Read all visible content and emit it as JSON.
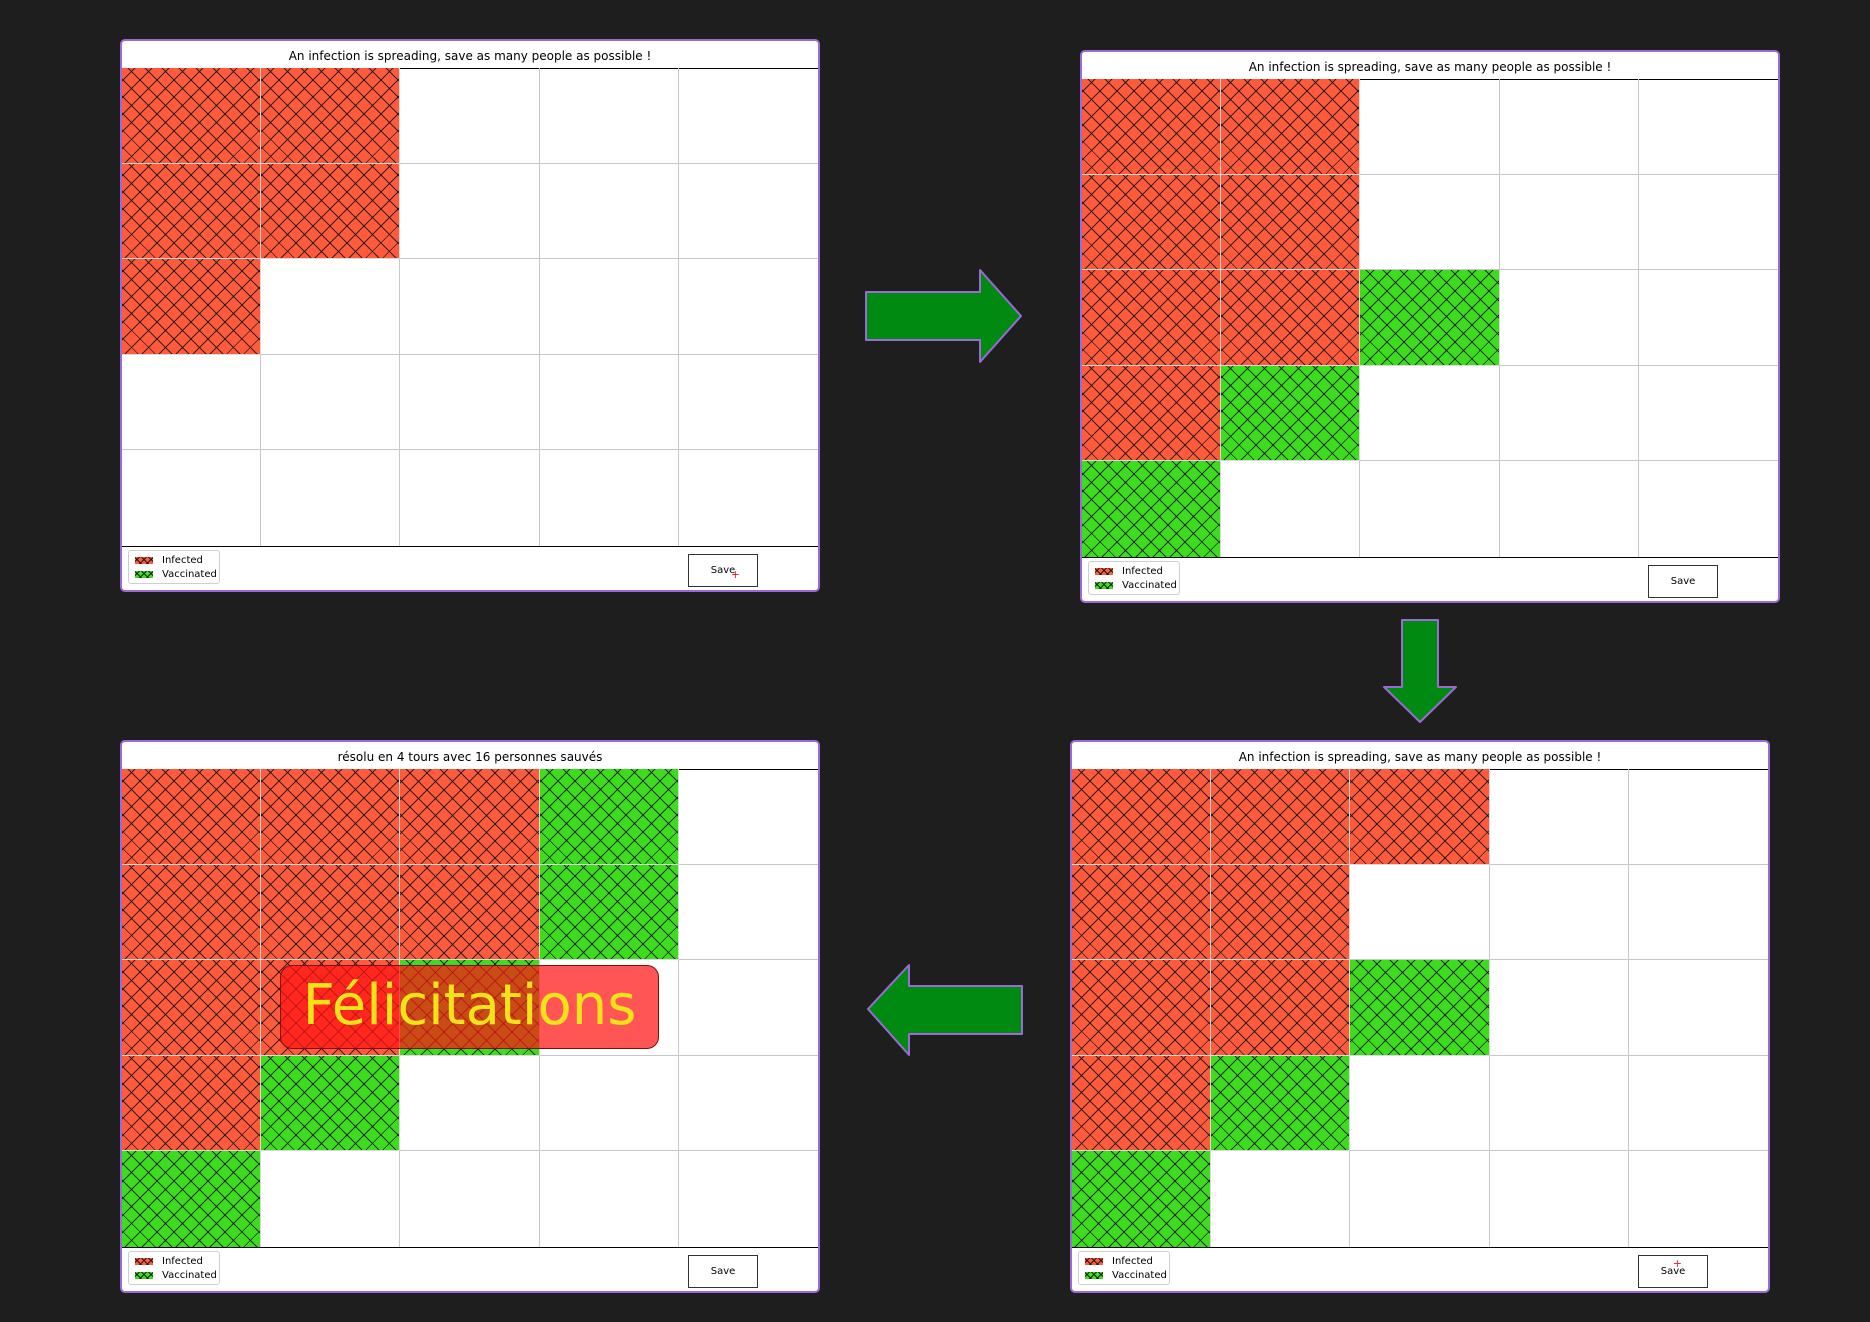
{
  "colors": {
    "infected": "#fe5a3c",
    "vaccinated": "#3ddc1e",
    "arrow_fill": "#008a12",
    "arrow_stroke": "#9b6ad6",
    "panel_border": "#9b6ad6",
    "congrats_text": "#f2e21a"
  },
  "legend": {
    "infected": "Infected",
    "vaccinated": "Vaccinated"
  },
  "save_label": "Save",
  "congrats": "Félicitations",
  "panels": [
    {
      "title": "An infection is spreading, save as many people as possible !",
      "grid": [
        [
          "I",
          "I",
          "",
          "",
          ""
        ],
        [
          "I",
          "I",
          "",
          "",
          ""
        ],
        [
          "I",
          "",
          "",
          "",
          ""
        ],
        [
          "",
          "",
          "",
          "",
          ""
        ],
        [
          "",
          "",
          "",
          "",
          ""
        ]
      ]
    },
    {
      "title": "An infection is spreading, save as many people as possible !",
      "grid": [
        [
          "I",
          "I",
          "",
          "",
          ""
        ],
        [
          "I",
          "I",
          "",
          "",
          ""
        ],
        [
          "I",
          "I",
          "V",
          "",
          ""
        ],
        [
          "I",
          "V",
          "",
          "",
          ""
        ],
        [
          "V",
          "",
          "",
          "",
          ""
        ]
      ]
    },
    {
      "title": "An infection is spreading, save as many people as possible !",
      "grid": [
        [
          "I",
          "I",
          "I",
          "",
          ""
        ],
        [
          "I",
          "I",
          "",
          "",
          ""
        ],
        [
          "I",
          "I",
          "V",
          "",
          ""
        ],
        [
          "I",
          "V",
          "",
          "",
          ""
        ],
        [
          "V",
          "",
          "",
          "",
          ""
        ]
      ]
    },
    {
      "title": "résolu en 4 tours avec 16 personnes sauvés",
      "grid": [
        [
          "I",
          "I",
          "I",
          "V",
          ""
        ],
        [
          "I",
          "I",
          "I",
          "V",
          ""
        ],
        [
          "I",
          "I",
          "V",
          "",
          ""
        ],
        [
          "I",
          "V",
          "",
          "",
          ""
        ],
        [
          "V",
          "",
          "",
          "",
          ""
        ]
      ]
    }
  ],
  "arrows": [
    {
      "icon": "arrow-right-icon"
    },
    {
      "icon": "arrow-down-icon"
    },
    {
      "icon": "arrow-left-icon"
    }
  ]
}
